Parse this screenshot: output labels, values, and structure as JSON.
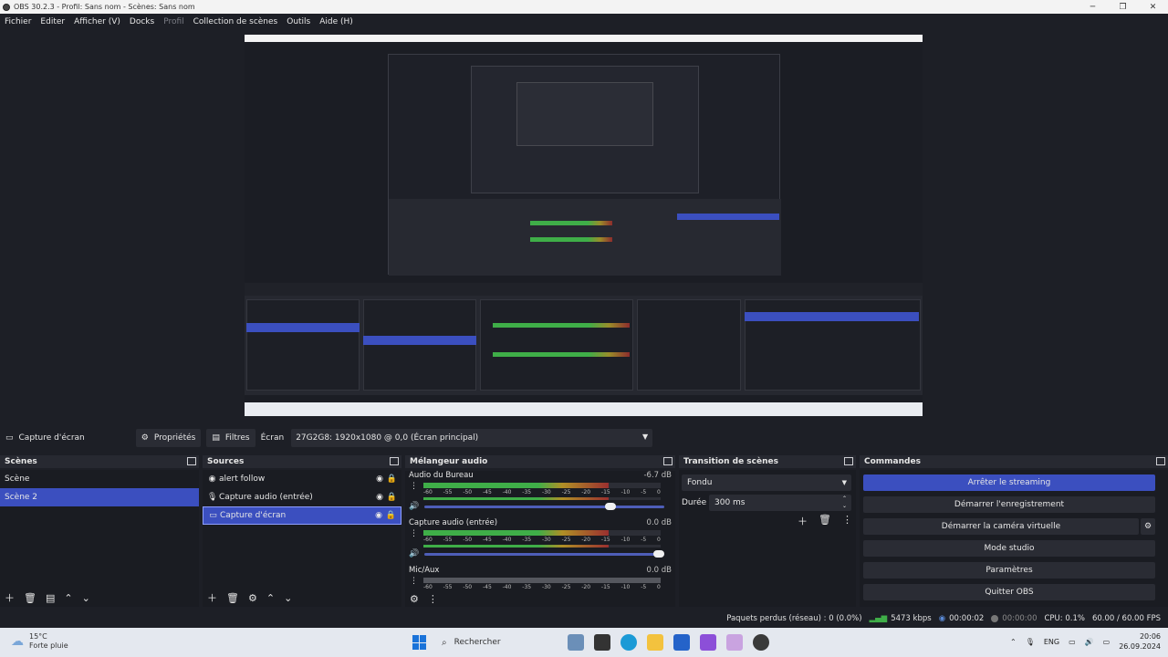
{
  "window": {
    "title": "OBS 30.2.3 - Profil: Sans nom - Scènes: Sans nom"
  },
  "menu": [
    "Fichier",
    "Editer",
    "Afficher (V)",
    "Docks",
    "Profil",
    "Collection de scènes",
    "Outils",
    "Aide (H)"
  ],
  "source_toolbar": {
    "source_name": "Capture d'écran",
    "properties_label": "Propriétés",
    "filters_label": "Filtres",
    "screen_label": "Écran",
    "screen_value": "27G2G8: 1920x1080 @ 0,0 (Écran principal)"
  },
  "scenes": {
    "title": "Scènes",
    "items": [
      "Scène",
      "Scène 2"
    ],
    "selected": "Scène 2"
  },
  "sources": {
    "title": "Sources",
    "items": [
      {
        "label": "alert follow",
        "icon": "globe-icon"
      },
      {
        "label": "Capture audio (entrée)",
        "icon": "microphone-icon"
      },
      {
        "label": "Capture d'écran",
        "icon": "monitor-icon"
      }
    ],
    "selected": "Capture d'écran"
  },
  "mixer": {
    "title": "Mélangeur audio",
    "scale": [
      "-60",
      "-55",
      "-50",
      "-45",
      "-40",
      "-35",
      "-30",
      "-25",
      "-20",
      "-15",
      "-10",
      "-5",
      "0"
    ],
    "tracks": [
      {
        "name": "Audio du Bureau",
        "db": "-6.7 dB",
        "level": 0.78,
        "volume": 0.8
      },
      {
        "name": "Capture audio (entrée)",
        "db": "0.0 dB",
        "level": 0.78,
        "volume": 1.0
      },
      {
        "name": "Mic/Aux",
        "db": "0.0 dB",
        "level": 0.0,
        "volume": 1.0
      }
    ]
  },
  "transition": {
    "title": "Transition de scènes",
    "type": "Fondu",
    "duration_label": "Durée",
    "duration_value": "300 ms"
  },
  "controls": {
    "title": "Commandes",
    "buttons": [
      "Arrêter le streaming",
      "Démarrer l'enregistrement",
      "Démarrer la caméra virtuelle",
      "Mode studio",
      "Paramètres",
      "Quitter OBS"
    ]
  },
  "status": {
    "dropped": "Paquets perdus (réseau) : 0 (0.0%)",
    "bitrate": "5473 kbps",
    "stream_time": "00:00:02",
    "rec_time": "00:00:00",
    "cpu": "CPU: 0.1%",
    "fps": "60.00 / 60.00 FPS"
  },
  "taskbar": {
    "temp": "15°C",
    "weather": "Forte pluie",
    "search_placeholder": "Rechercher",
    "lang": "ENG",
    "time": "20:06",
    "date": "26.09.2024"
  },
  "colors": {
    "accent": "#3b4fbf",
    "background": "#1d1f26",
    "meter_green": "#3fae48"
  }
}
